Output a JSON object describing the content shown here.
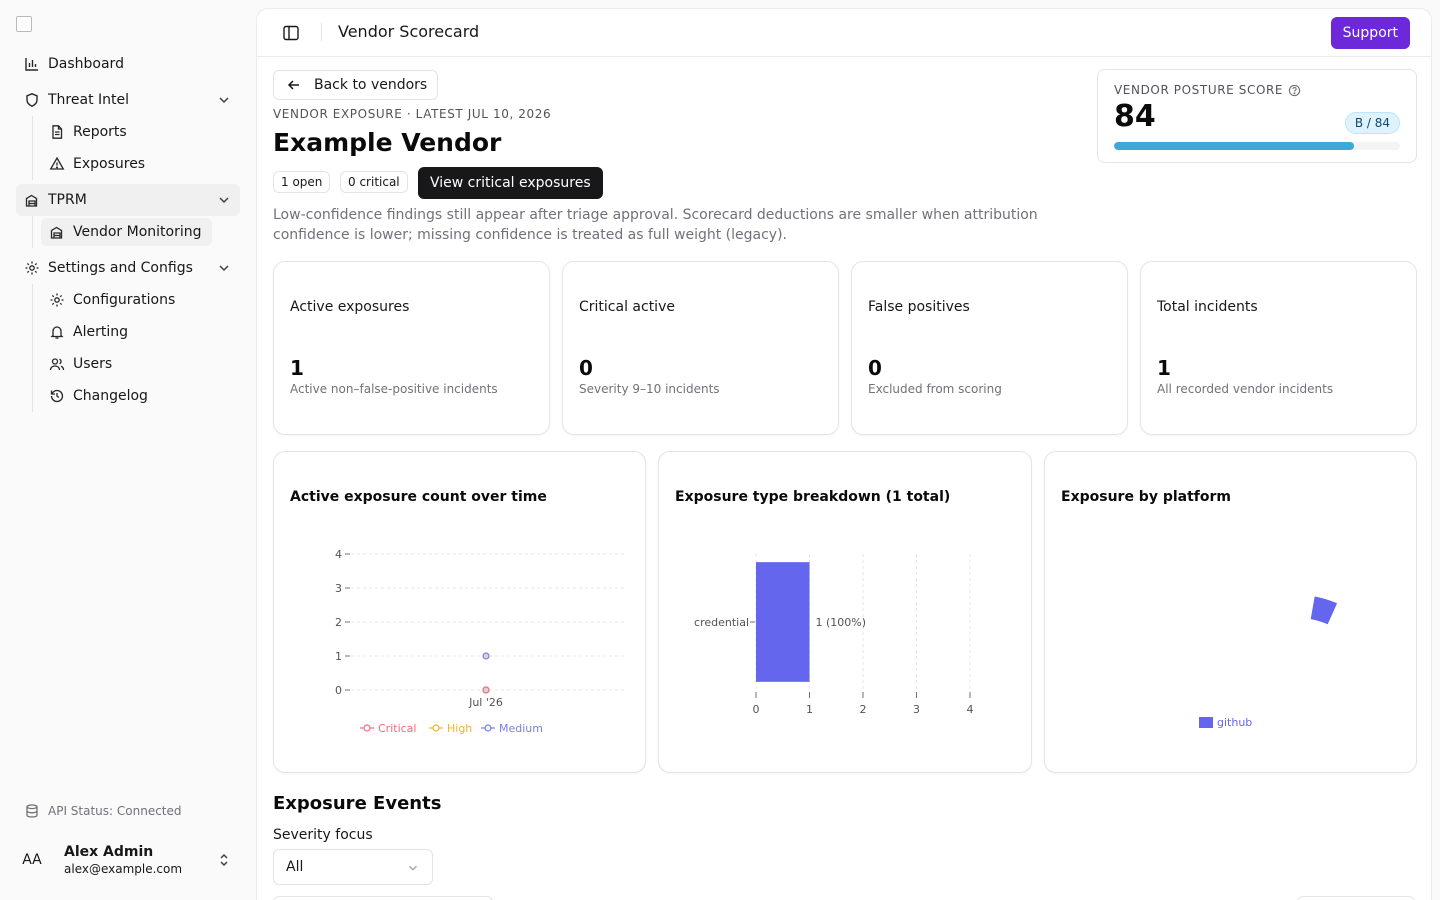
{
  "sidebar": {
    "items": [
      {
        "label": "Dashboard",
        "icon": "bar-chart-icon"
      },
      {
        "label": "Threat Intel",
        "icon": "shield-icon",
        "children": [
          {
            "label": "Reports",
            "icon": "document-icon"
          },
          {
            "label": "Exposures",
            "icon": "warning-triangle-icon"
          }
        ]
      },
      {
        "label": "TPRM",
        "icon": "building-icon",
        "children": [
          {
            "label": "Vendor Monitoring",
            "icon": "building-icon"
          }
        ]
      },
      {
        "label": "Settings and Configs",
        "icon": "gear-icon",
        "children": [
          {
            "label": "Configurations",
            "icon": "gear-icon"
          },
          {
            "label": "Alerting",
            "icon": "bell-icon"
          },
          {
            "label": "Users",
            "icon": "users-icon"
          },
          {
            "label": "Changelog",
            "icon": "history-icon"
          }
        ]
      }
    ],
    "api_status": "API Status: Connected",
    "user": {
      "initials": "AA",
      "name": "Alex Admin",
      "email": "alex@example.com"
    }
  },
  "header": {
    "title": "Vendor Scorecard",
    "support_label": "Support"
  },
  "vendor": {
    "back_label": "Back to vendors",
    "eyebrow": "VENDOR EXPOSURE · LATEST JUL 10, 2026",
    "name": "Example Vendor",
    "badges": [
      "1 open",
      "0 critical"
    ],
    "critical_button": "View critical exposures",
    "note": "Low-confidence findings still appear after triage approval. Scorecard deductions are smaller when attribution confidence is lower; missing confidence is treated as full weight (legacy)."
  },
  "score": {
    "label": "VENDOR POSTURE SCORE",
    "value": "84",
    "grade": "B / 84",
    "percent": 84,
    "bar_color": "#3ea8d8"
  },
  "stats": [
    {
      "title": "Active exposures",
      "value": "1",
      "sub": "Active non–false-positive incidents"
    },
    {
      "title": "Critical active",
      "value": "0",
      "sub": "Severity 9–10 incidents"
    },
    {
      "title": "False positives",
      "value": "0",
      "sub": "Excluded from scoring"
    },
    {
      "title": "Total incidents",
      "value": "1",
      "sub": "All recorded vendor incidents"
    }
  ],
  "colors": {
    "accent": "#6d28d9",
    "critical": "#f06a7c",
    "high": "#f0b429",
    "medium": "#7b7fe0",
    "bar": "#6466ee"
  },
  "chart_data": [
    {
      "type": "line",
      "title": "Active exposure count over time",
      "x": [
        "Jul '26"
      ],
      "series": [
        {
          "name": "Critical",
          "values": [
            0
          ]
        },
        {
          "name": "High",
          "values": [
            0
          ]
        },
        {
          "name": "Medium",
          "values": [
            1
          ]
        }
      ],
      "yticks": [
        0,
        1,
        2,
        3,
        4
      ],
      "ylim": [
        0,
        4
      ],
      "grid": true,
      "legend": "bottom"
    },
    {
      "type": "bar",
      "orientation": "horizontal",
      "title": "Exposure type breakdown (1 total)",
      "categories": [
        "credential"
      ],
      "values": [
        1
      ],
      "labels": [
        "1 (100%)"
      ],
      "xticks": [
        0,
        1,
        2,
        3,
        4
      ],
      "xlim": [
        0,
        4
      ],
      "grid": true
    },
    {
      "type": "pie",
      "title": "Exposure by platform",
      "categories": [
        "github"
      ],
      "values": [
        1
      ],
      "legend": "bottom"
    }
  ],
  "events": {
    "title": "Exposure Events",
    "severity_label": "Severity focus",
    "severity_value": "All"
  }
}
